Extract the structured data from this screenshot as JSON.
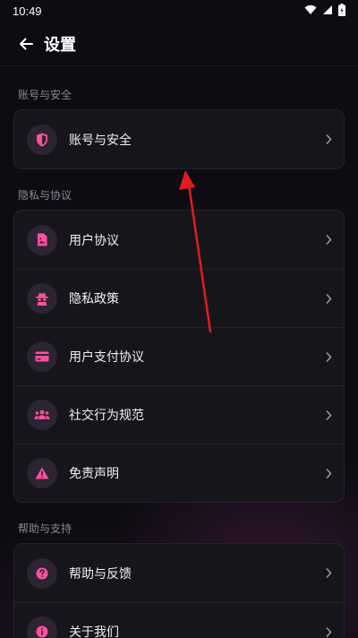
{
  "status_bar": {
    "time": "10:49",
    "icons": [
      "wifi-icon",
      "signal-icon",
      "battery-icon"
    ]
  },
  "header": {
    "back_icon": "arrow-left-icon",
    "title": "设置"
  },
  "sections": [
    {
      "label": "账号与安全",
      "items": [
        {
          "label": "账号与安全",
          "icon": "shield-icon"
        }
      ]
    },
    {
      "label": "隐私与协议",
      "items": [
        {
          "label": "用户协议",
          "icon": "document-icon"
        },
        {
          "label": "隐私政策",
          "icon": "spy-icon"
        },
        {
          "label": "用户支付协议",
          "icon": "credit-card-icon"
        },
        {
          "label": "社交行为规范",
          "icon": "people-icon"
        },
        {
          "label": "免责声明",
          "icon": "warning-icon"
        }
      ]
    },
    {
      "label": "帮助与支持",
      "items": [
        {
          "label": "帮助与反馈",
          "icon": "help-icon"
        },
        {
          "label": "关于我们",
          "icon": "info-icon"
        }
      ]
    }
  ],
  "colors": {
    "accent": "#ff4fa0",
    "background": "#0e0c12",
    "card": "#17151c",
    "annotation_arrow": "#e01e1e"
  }
}
